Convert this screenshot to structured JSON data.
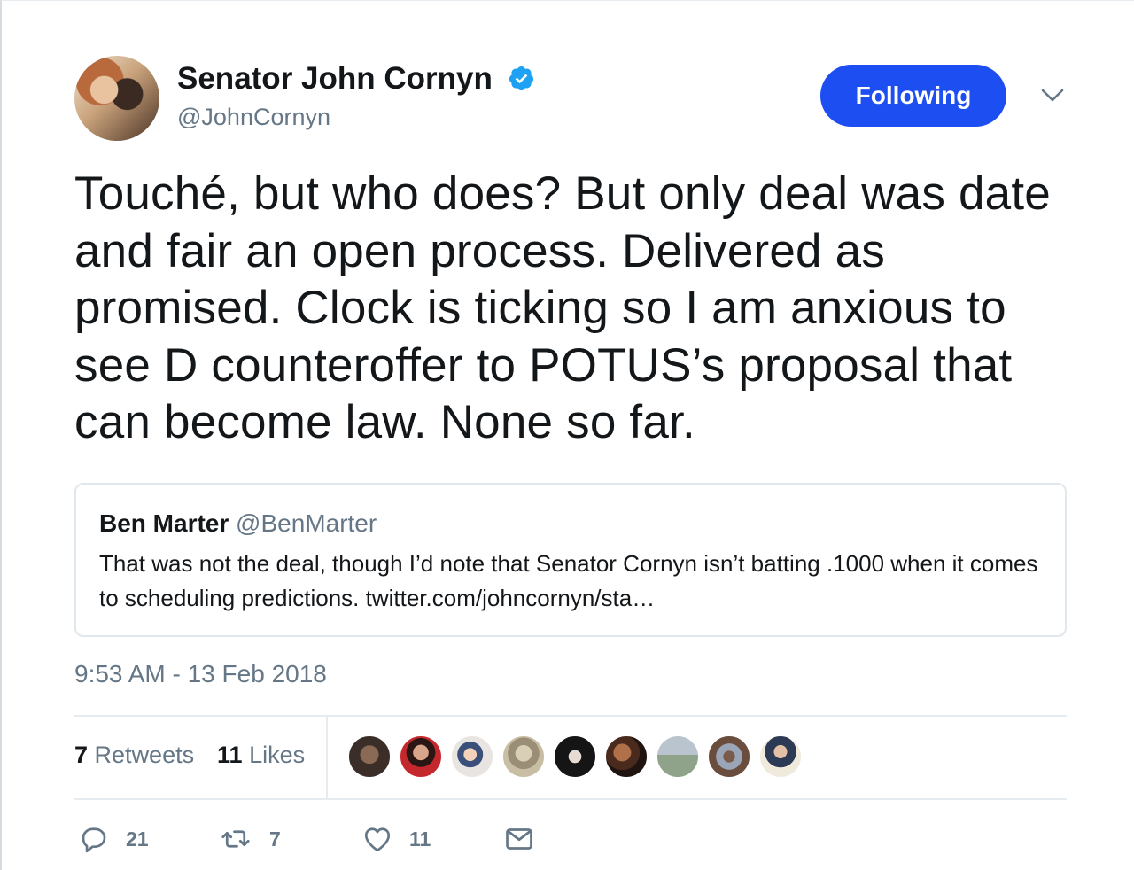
{
  "tweet": {
    "author": {
      "display_name": "Senator John Cornyn",
      "handle": "@JohnCornyn",
      "verified": true
    },
    "follow_button_label": "Following",
    "text": "Touché, but who does?  But only deal was date and fair an open process. Delivered as promised.  Clock is ticking so I am anxious to see D counteroffer to POTUS’s proposal that can become law.  None so far.",
    "quoted": {
      "display_name": "Ben Marter",
      "handle": "@BenMarter",
      "text": "That was not the deal, though I’d note that Senator Cornyn isn’t batting .1000 when it comes to scheduling predictions. twitter.com/johncornyn/sta…"
    },
    "timestamp": "9:53 AM - 13 Feb 2018",
    "stats": {
      "retweets_count": "7",
      "retweets_label": "Retweets",
      "likes_count": "11",
      "likes_label": "Likes"
    },
    "likers": [
      "liker-1",
      "liker-2",
      "liker-3",
      "liker-4",
      "liker-5",
      "liker-6",
      "liker-7",
      "liker-8",
      "liker-9"
    ],
    "actions": {
      "reply_count": "21",
      "retweet_count": "7",
      "like_count": "11"
    }
  },
  "colors": {
    "accent": "#1d4ef2",
    "verified": "#1da1f2",
    "text": "#14171a",
    "muted": "#657786",
    "border": "#e1e8ed"
  },
  "icons": [
    "verified-badge-icon",
    "chevron-down-icon",
    "reply-icon",
    "retweet-icon",
    "like-heart-icon",
    "direct-message-icon"
  ]
}
